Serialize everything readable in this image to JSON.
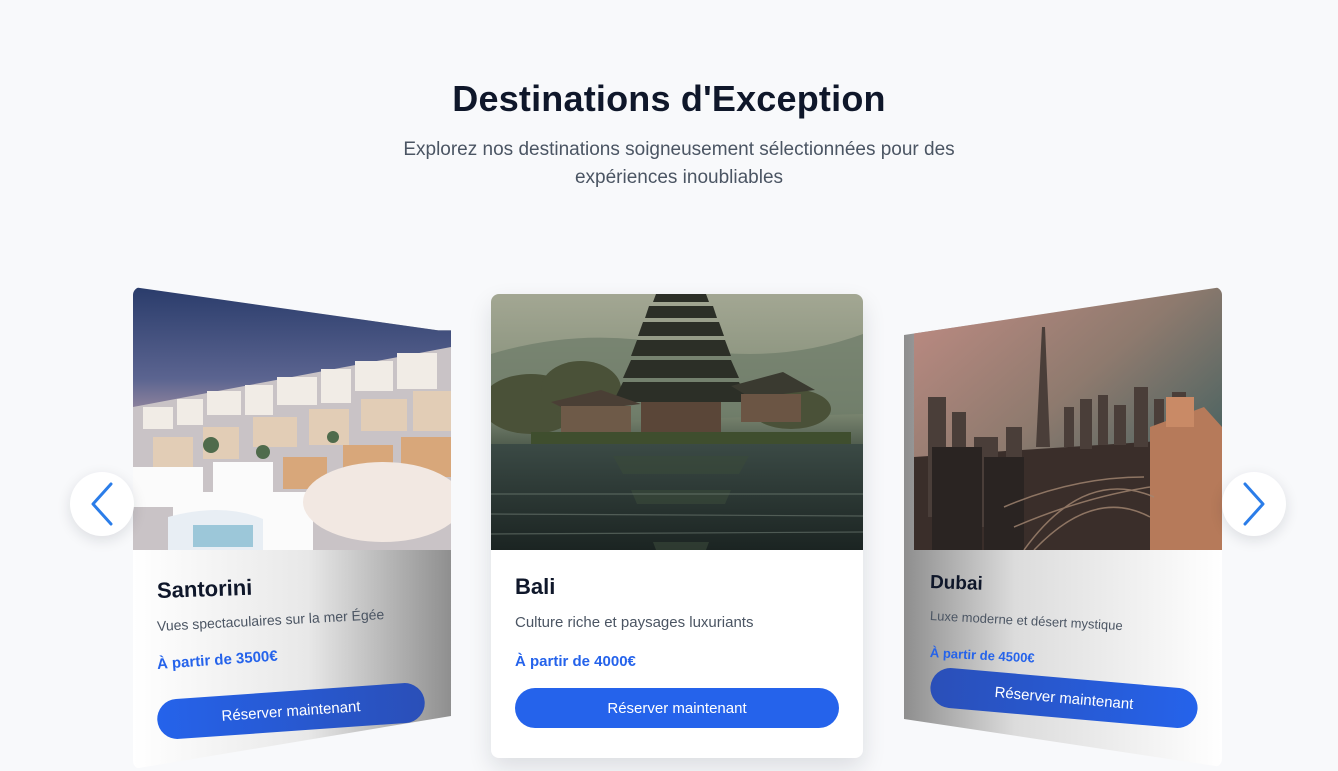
{
  "header": {
    "title": "Destinations d'Exception",
    "subtitle": "Explorez nos destinations soigneusement sélectionnées pour des expériences inoubliables"
  },
  "carousel": {
    "cards": [
      {
        "name": "Santorini",
        "description": "Vues spectaculaires sur la mer Égée",
        "price": "À partir de 3500€",
        "button": "Réserver maintenant"
      },
      {
        "name": "Bali",
        "description": "Culture riche et paysages luxuriants",
        "price": "À partir de 4000€",
        "button": "Réserver maintenant"
      },
      {
        "name": "Dubai",
        "description": "Luxe moderne et désert mystique",
        "price": "À partir de 4500€",
        "button": "Réserver maintenant"
      }
    ],
    "prev_icon": "chevron-left-icon",
    "next_icon": "chevron-right-icon"
  },
  "colors": {
    "accent": "#2563eb",
    "background": "#f8f9fb",
    "heading": "#0f172a",
    "text": "#4b5563"
  }
}
